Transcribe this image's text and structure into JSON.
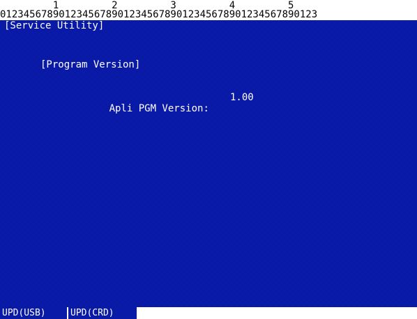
{
  "ruler": {
    "tens": "         1         2         3         4         5",
    "ones": "012345678901234567890123456789012345678901234567890123"
  },
  "screen": {
    "title": "[Service Utility]",
    "section": "[Program Version]",
    "version_label": "Apli PGM Version:",
    "version_value": "1.00"
  },
  "softkeys": {
    "key1": "UPD(USB)",
    "key2": "UPD(CRD)"
  },
  "colors": {
    "screen_bg": "#0a1aa8",
    "text": "#ffffff"
  }
}
